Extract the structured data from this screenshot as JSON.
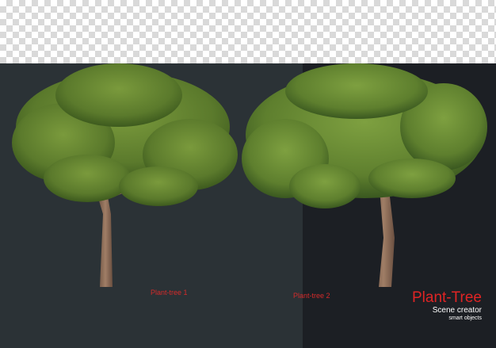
{
  "labels": {
    "tree1": "Plant-tree 1",
    "tree2": "Plant-tree 2"
  },
  "brand": {
    "title": "Plant-Tree",
    "subtitle": "Scene creator",
    "tagline": "smart objects"
  },
  "colors": {
    "label_red": "#d42a2a",
    "panel_left": "#2b3236",
    "panel_right": "#1c1f24",
    "foliage": "#5b7a2c",
    "trunk": "#8a6a55"
  }
}
